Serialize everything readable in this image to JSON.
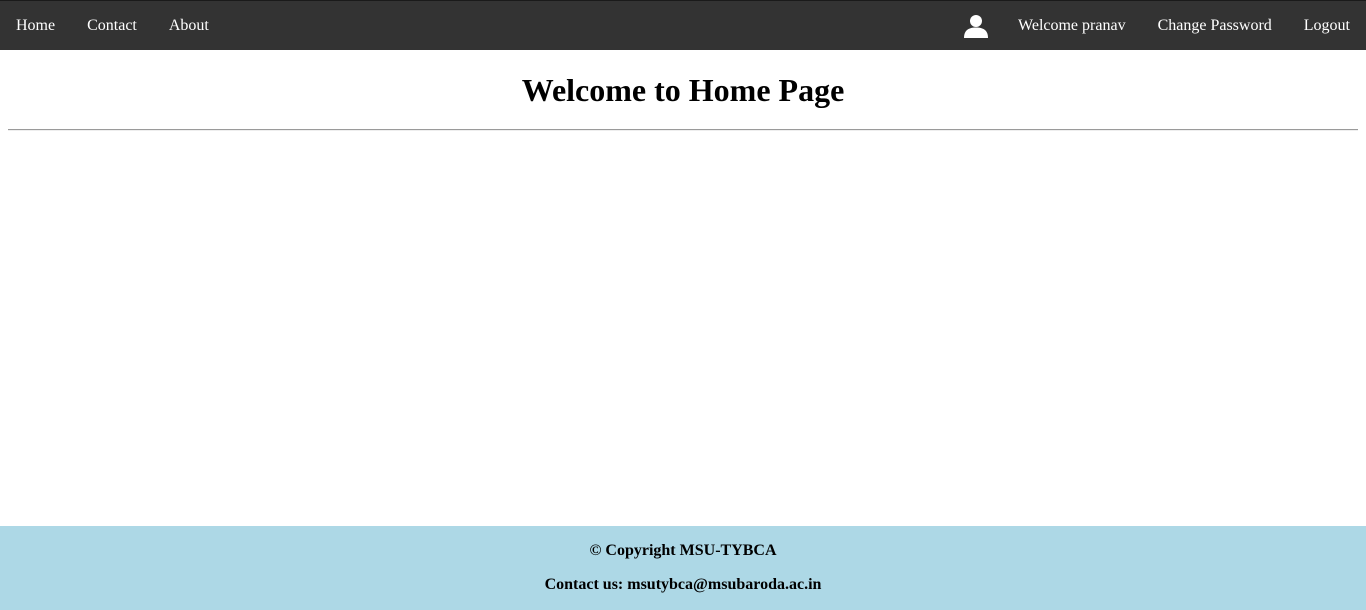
{
  "nav": {
    "left_items": [
      {
        "label": "Home"
      },
      {
        "label": "Contact"
      },
      {
        "label": "About"
      }
    ],
    "user_icon": "user-icon",
    "welcome": "Welcome pranav",
    "change_password": "Change Password",
    "logout": "Logout"
  },
  "main": {
    "title": "Welcome to Home Page"
  },
  "footer": {
    "copyright": "© Copyright MSU-TYBCA",
    "contact": "Contact us: msutybca@msubaroda.ac.in"
  },
  "colors": {
    "navbar_bg": "#333333",
    "footer_bg": "#add8e6"
  }
}
